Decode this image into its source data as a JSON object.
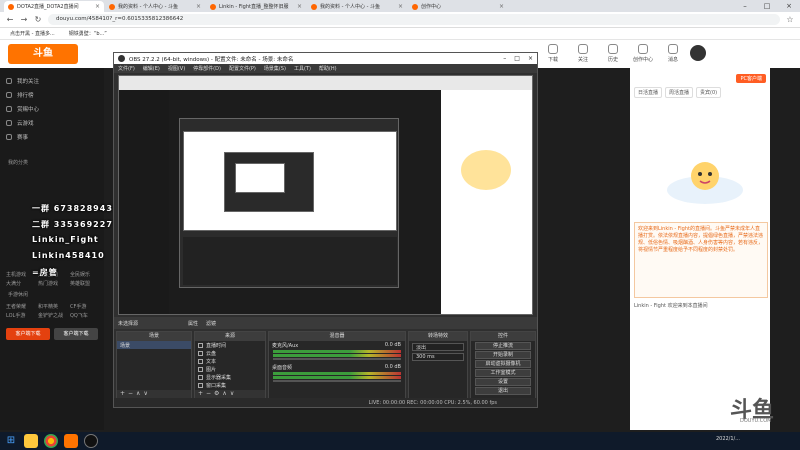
{
  "browser": {
    "tabs": [
      {
        "label": "DOTA2直播_DOTA2直播间",
        "active": true
      },
      {
        "label": "我的资料 - 个人中心 - 斗鱼"
      },
      {
        "label": "Linkin - Fight直播_整整怀旧服"
      },
      {
        "label": "我的资料 - 个人中心 - 斗鱼"
      },
      {
        "label": "创作中心"
      }
    ],
    "url": "douyu.com/458410?_r=0.6015335812386642",
    "bookmarks": [
      "点击开黑 - 直播多...",
      "钢铁勇壁：“b...”"
    ]
  },
  "douyu": {
    "logo": "斗鱼",
    "top_icons": [
      "下载",
      "关注",
      "历史",
      "创作中心",
      "消息"
    ],
    "sidebar": {
      "main": [
        "我的关注",
        "排行榜",
        "赏赐中心",
        "云游戏",
        "赛事"
      ],
      "section1": "我的分类",
      "section2": "手游休闲",
      "grid1": [
        "主机游戏",
        "大秀互动",
        "全民娱乐",
        "大满分",
        "热门游戏",
        "英雄联盟"
      ],
      "grid2": [
        "王者荣耀",
        "和平精英",
        "CF手游",
        "LOL手游",
        "金铲铲之战",
        "QQ飞车"
      ],
      "buttons": [
        "客户端下载",
        "客户端下载"
      ]
    },
    "chat": {
      "tabs": [
        "日活直播",
        "周活直播",
        "贵宾(0)"
      ],
      "badge": "PC客户端",
      "notice": "欢迎来到Linkin - Fight的直播间。斗鱼严禁未成年人直播打赏。依法依规直播内容，提倡绿色直播，严禁违法违规、低俗色情、吸烟酗酒、人身伤害等内容，若有违反，将视情节严重程度给予不同程度的封禁处罚。",
      "message": "Linkin - Fight 欢迎来到本直播间"
    },
    "room_number": "458410",
    "watermark": "DOUYU.COM"
  },
  "obs": {
    "title": "OBS 27.2.2 (64-bit, windows) - 配置文件: 未命名 - 场景: 未命名",
    "menu": [
      "文件(F)",
      "编辑(E)",
      "视图(V)",
      "停靠部件(D)",
      "配置文件(P)",
      "场景集(S)",
      "工具(T)",
      "帮助(H)"
    ],
    "dock_bar": [
      "未选择源",
      "属性",
      "滤镜"
    ],
    "scenes_header": "场景",
    "scene_item": "场景",
    "sources_header": "来源",
    "sources": [
      "直播时间",
      "云盘",
      "文本",
      "图片",
      "显示器采集",
      "窗口采集"
    ],
    "mixer_header": "混音器",
    "mixer": [
      {
        "label": "麦克风/Aux",
        "db": "0.0 dB"
      },
      {
        "label": "桌面音频",
        "db": "0.0 dB"
      }
    ],
    "transitions_header": "转场特效",
    "transition": "淡出",
    "duration": "300 ms",
    "controls_header": "控件",
    "controls": [
      "停止推流",
      "开始录制",
      "启动虚拟摄像机",
      "工作室模式",
      "设置",
      "退出"
    ],
    "status": "LIVE: 00:00:00   REC: 00:00:00   CPU: 2.5%, 60.00 fps"
  },
  "overlay": {
    "line1": "一群 673828943",
    "line2": "二群 335369227",
    "line3": "Linkin_Fight",
    "line4": "Linkin458410",
    "line5": "=房管"
  },
  "taskbar": {
    "clock": "2022/1/..."
  }
}
